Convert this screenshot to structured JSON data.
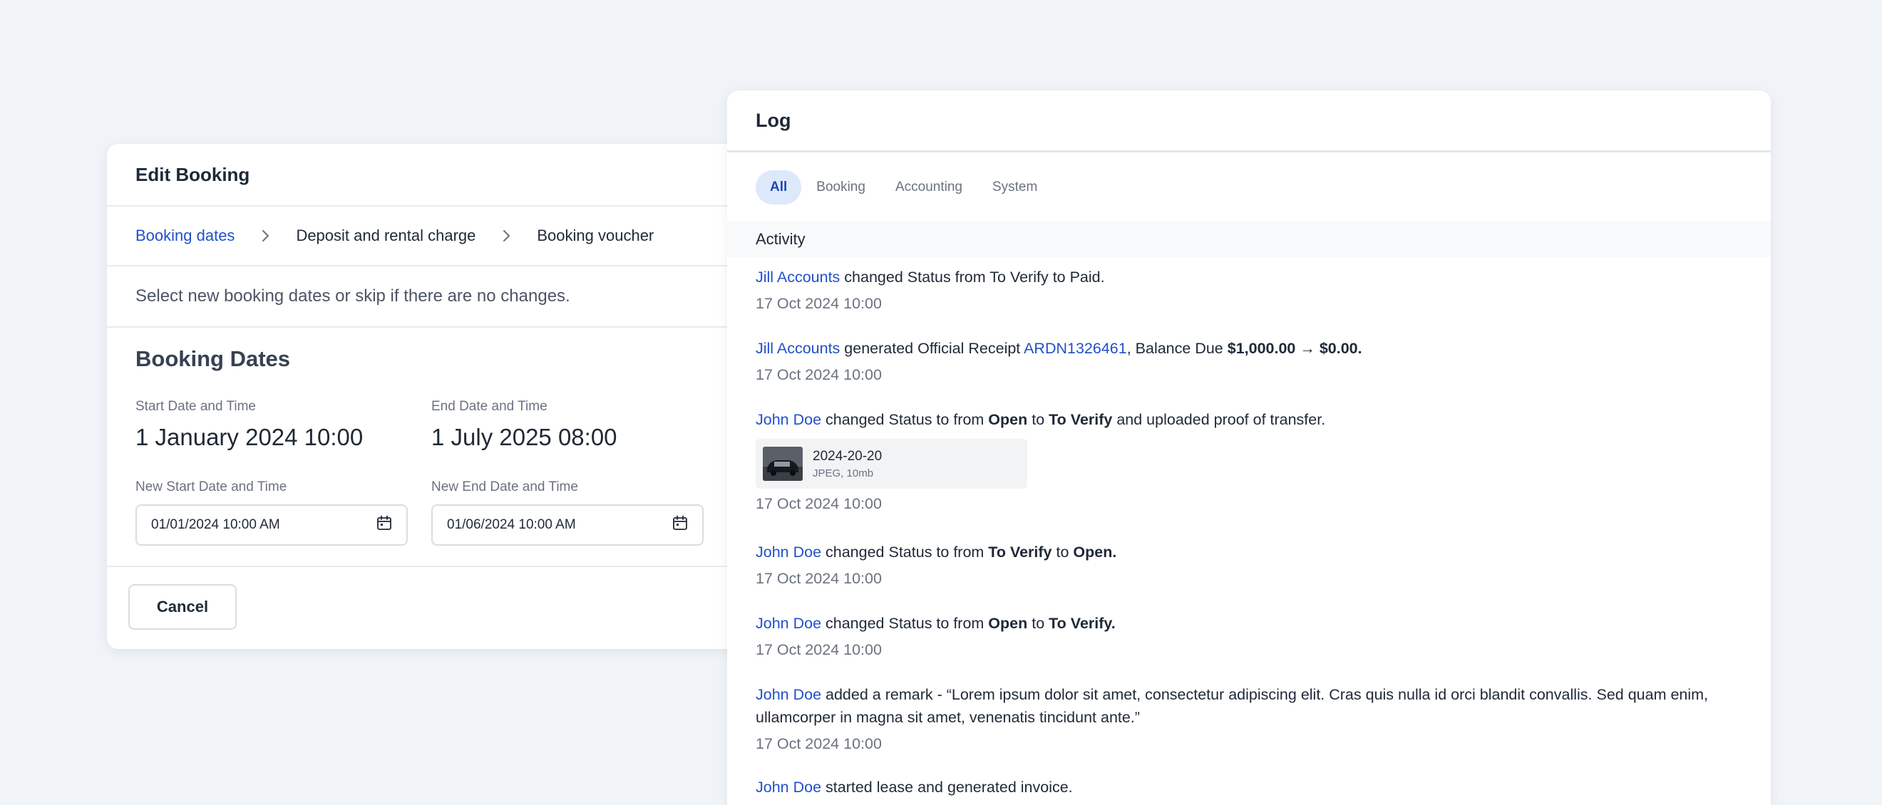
{
  "edit_booking": {
    "title": "Edit Booking",
    "steps": [
      "Booking dates",
      "Deposit and rental charge",
      "Booking voucher"
    ],
    "description": "Select new booking dates or skip if there are no changes.",
    "section_title": "Booking Dates",
    "start_label": "Start Date and Time",
    "start_value": "1 January 2024 10:00",
    "end_label": "End Date and Time",
    "end_value": "1 July 2025 08:00",
    "new_start_label": "New Start Date and Time",
    "new_start_value": "01/01/2024 10:00 AM",
    "new_end_label": "New End Date and Time",
    "new_end_value": "01/06/2024 10:00 AM",
    "cancel_label": "Cancel"
  },
  "log": {
    "title": "Log",
    "tabs": [
      "All",
      "Booking",
      "Accounting",
      "System"
    ],
    "activity_label": "Activity",
    "entries": [
      {
        "actor": "Jill Accounts",
        "text1": " changed Status from To Verify to Paid.",
        "time": "17 Oct 2024 10:00"
      },
      {
        "actor": "Jill Accounts",
        "text1": " generated Official Receipt ",
        "link": "ARDN1326461",
        "text2": ", Balance Due ",
        "bold1": "$1,000.00 → $0.00.",
        "time": "17 Oct 2024 10:00"
      },
      {
        "actor": "John Doe",
        "text1": " changed Status to from ",
        "bold1": "Open",
        "text2": " to ",
        "bold2": "To Verify",
        "text3": " and uploaded proof of transfer.",
        "attachment_name": "2024-20-20",
        "attachment_meta": "JPEG, 10mb",
        "time": "17 Oct 2024 10:00"
      },
      {
        "actor": "John Doe",
        "text1": " changed Status to from ",
        "bold1": "To Verify",
        "text2": " to ",
        "bold2": "Open.",
        "time": "17 Oct 2024 10:00"
      },
      {
        "actor": "John Doe",
        "text1": " changed Status to from ",
        "bold1": "Open",
        "text2": " to ",
        "bold2": "To Verify.",
        "time": "17 Oct 2024 10:00"
      },
      {
        "actor": "John Doe",
        "text1": " added a remark - “Lorem ipsum dolor sit amet, consectetur adipiscing elit. Cras quis nulla id orci blandit convallis. Sed quam enim, ullamcorper in magna sit amet, venenatis tincidunt ante.”",
        "time": "17 Oct 2024 10:00"
      },
      {
        "actor": "John Doe",
        "text1": " started lease and generated invoice."
      }
    ]
  },
  "colors": {
    "accent": "#2150c8",
    "background": "#f0f3f8",
    "active_tab_bg": "#dde9fb"
  },
  "icons": {
    "step_separator": "chevron-right-icon",
    "date_picker": "calendar-icon"
  }
}
